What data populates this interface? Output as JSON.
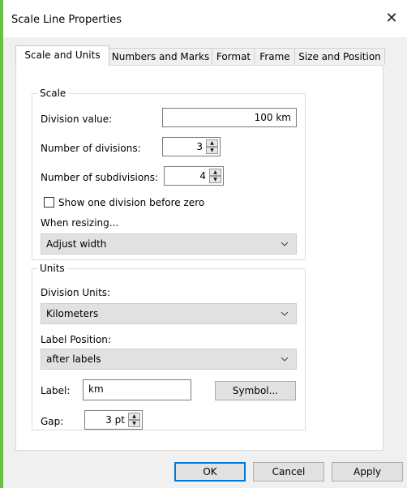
{
  "dialog": {
    "title": "Scale Line Properties",
    "close_glyph": "✕"
  },
  "tabs": [
    {
      "label": "Scale and Units",
      "active": true
    },
    {
      "label": "Numbers and Marks",
      "active": false
    },
    {
      "label": "Format",
      "active": false
    },
    {
      "label": "Frame",
      "active": false
    },
    {
      "label": "Size and Position",
      "active": false
    }
  ],
  "scale_group": {
    "title": "Scale",
    "division_value_label": "Division value:",
    "division_value": "100 km",
    "num_divisions_label": "Number of divisions:",
    "num_divisions": "3",
    "num_subdivisions_label": "Number of subdivisions:",
    "num_subdivisions": "4",
    "show_one_division_label": "Show one division before zero",
    "show_one_division_checked": false,
    "when_resizing_label": "When resizing...",
    "when_resizing_value": "Adjust width"
  },
  "units_group": {
    "title": "Units",
    "division_units_label": "Division Units:",
    "division_units_value": "Kilometers",
    "label_position_label": "Label Position:",
    "label_position_value": "after labels",
    "label_label": "Label:",
    "label_value": "km",
    "symbol_button": "Symbol...",
    "gap_label": "Gap:",
    "gap_value": "3 pt"
  },
  "footer": {
    "ok": "OK",
    "cancel": "Cancel",
    "apply": "Apply"
  },
  "colors": {
    "accent": "#6abf4b",
    "default_button_border": "#0078d7"
  },
  "icons": {
    "spinner_up": "▲",
    "spinner_down": "▼",
    "dropdown": "chevron-down-icon"
  }
}
